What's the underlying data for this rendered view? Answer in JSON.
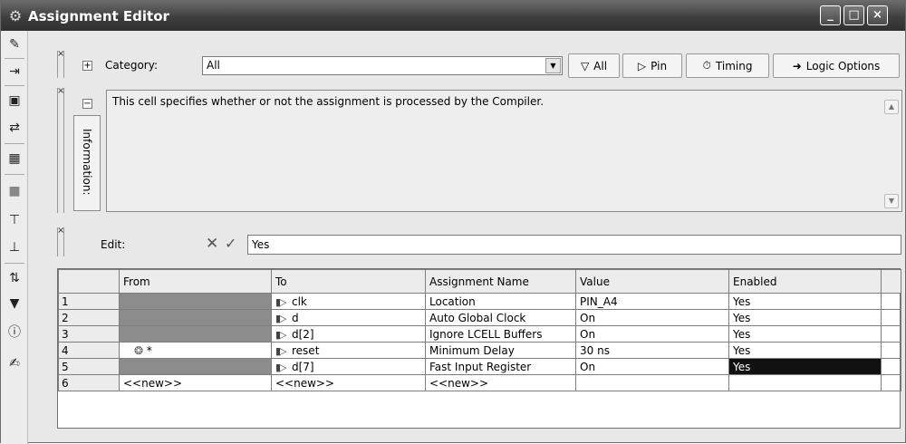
{
  "window": {
    "title": "Assignment Editor",
    "title_icon": "wrench-icon"
  },
  "category_bar": {
    "label": "Category:",
    "value": "All",
    "buttons": [
      {
        "label": "All",
        "icon": "filter-icon"
      },
      {
        "label": "Pin",
        "icon": "pin-icon"
      },
      {
        "label": "Timing",
        "icon": "stopwatch-icon"
      },
      {
        "label": "Logic Options",
        "icon": "arrow-right-icon"
      }
    ]
  },
  "information": {
    "label": "Information:",
    "text": "This cell specifies whether or not the assignment is processed by the Compiler."
  },
  "edit_bar": {
    "label": "Edit:",
    "value": "Yes"
  },
  "grid": {
    "columns": [
      "From",
      "To",
      "Assignment Name",
      "Value",
      "Enabled"
    ],
    "rows": [
      {
        "num": "1",
        "from": "",
        "to": "clk",
        "name": "Location",
        "value": "PIN_A4",
        "enabled": "Yes"
      },
      {
        "num": "2",
        "from": "",
        "to": "d",
        "name": "Auto Global Clock",
        "value": "On",
        "enabled": "Yes"
      },
      {
        "num": "3",
        "from": "",
        "to": "d[2]",
        "name": "Ignore LCELL Buffers",
        "value": "On",
        "enabled": "Yes"
      },
      {
        "num": "4",
        "from": "*",
        "to": "reset",
        "name": "Minimum Delay",
        "value": "30 ns",
        "enabled": "Yes"
      },
      {
        "num": "5",
        "from": "",
        "to": "d[7]",
        "name": "Fast Input Register",
        "value": "On",
        "enabled": "Yes"
      },
      {
        "num": "6",
        "from": "<<new>>",
        "to": "<<new>>",
        "name": "<<new>>",
        "value": "",
        "enabled": ""
      }
    ]
  }
}
